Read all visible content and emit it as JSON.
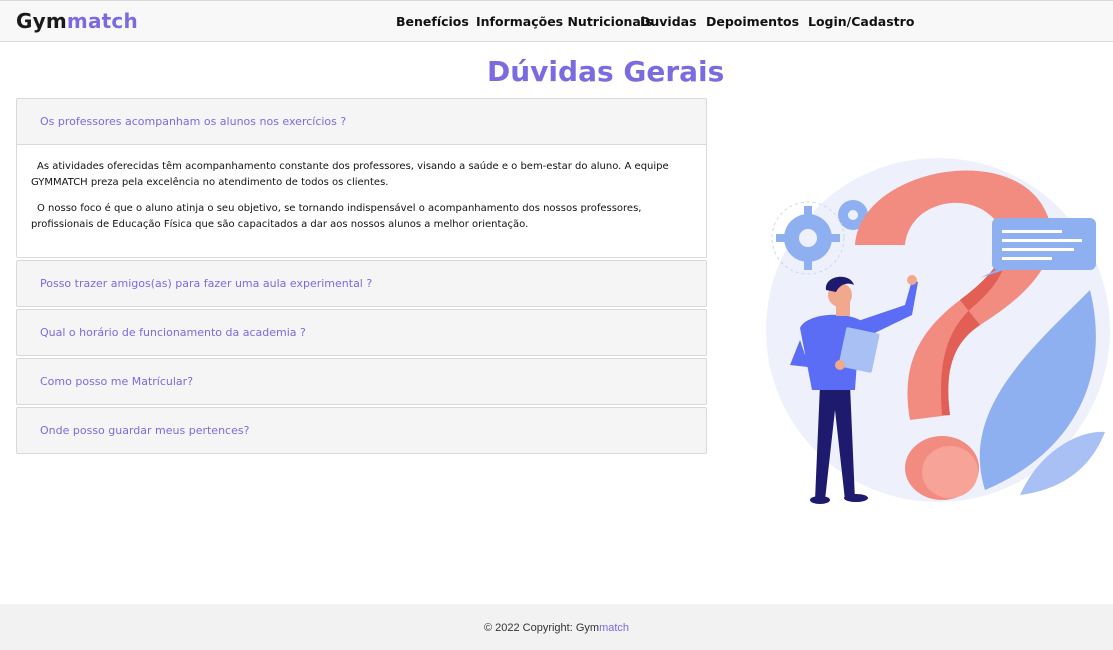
{
  "brand": {
    "part1": "Gym",
    "part2": "match"
  },
  "nav": {
    "items": [
      "Benefícios",
      "Informações Nutricionais",
      "Duvidas",
      "Depoimentos",
      "Login/Cadastro"
    ]
  },
  "page": {
    "title": "Dúvidas Gerais"
  },
  "faq": {
    "items": [
      {
        "question": "Os professores acompanham os alunos nos exercícios ?",
        "answer_1": "As atividades oferecidas têm acompanhamento constante dos professores, visando a saúde e o bem-estar do aluno. A equipe GYMMATCH preza pela excelência no atendimento de todos os clientes.",
        "answer_2": "O nosso foco é que o aluno atinja o seu objetivo, se tornando indispensável o acompanhamento dos nossos professores, profissionais de Educação Física que são capacitados a dar aos nossos alunos a melhor orientação."
      },
      {
        "question": "Posso trazer amigos(as) para fazer uma aula experimental ?"
      },
      {
        "question": "Qual o horário de funcionamento da academia ?"
      },
      {
        "question": "Como posso me Matrícular?"
      },
      {
        "question": "Onde posso guardar meus pertences?"
      }
    ]
  },
  "footer": {
    "prefix": "© 2022 Copyright: ",
    "brand1": "Gym",
    "brand2": "match"
  },
  "colors": {
    "accent": "#7c6be0",
    "navbar_bg": "#f8f8f8",
    "footer_bg": "#f2f2f2"
  },
  "illustration": {
    "icon": "question-mark-person-illustration"
  }
}
